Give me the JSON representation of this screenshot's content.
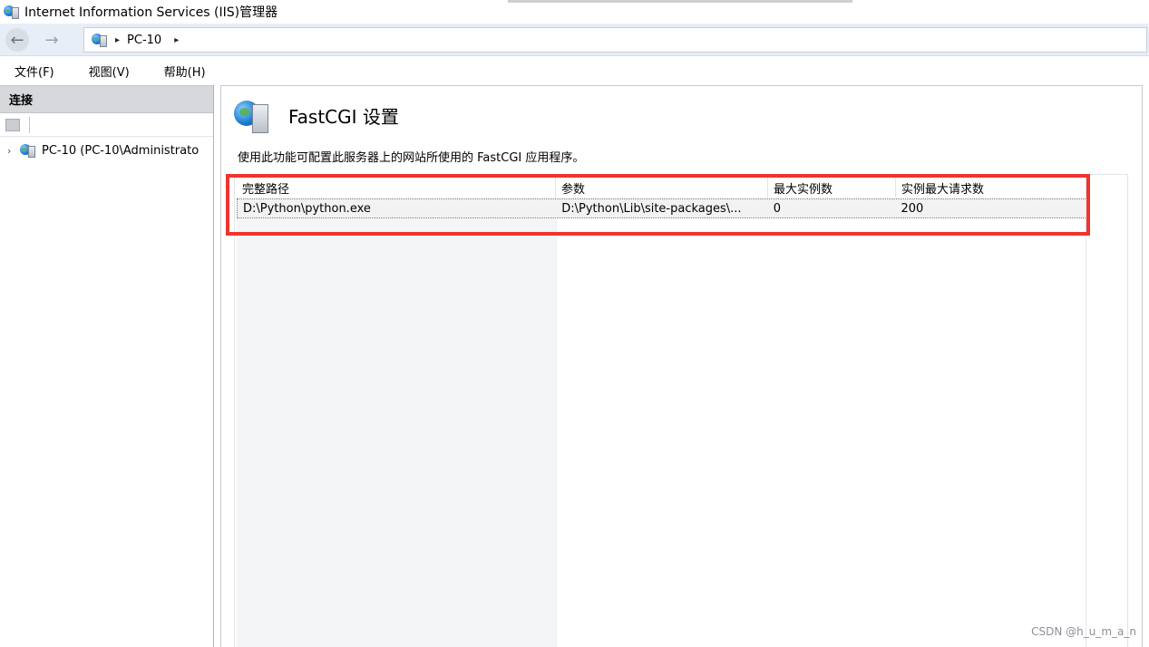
{
  "window": {
    "title": "Internet Information Services (IIS)管理器"
  },
  "address": {
    "crumb": "PC-10",
    "arrow": "▸"
  },
  "nav": {
    "back": "←",
    "forward": "→"
  },
  "menu": [
    "文件(F)",
    "视图(V)",
    "帮助(H)"
  ],
  "connections": {
    "header": "连接",
    "node": {
      "expander": "›",
      "label": "PC-10 (PC-10\\Administrato"
    }
  },
  "feature": {
    "title": "FastCGI 设置",
    "description": "使用此功能可配置此服务器上的网站所使用的 FastCGI 应用程序。"
  },
  "grid": {
    "columns": [
      "完整路径",
      "参数",
      "最大实例数",
      "实例最大请求数"
    ],
    "rows": [
      [
        "D:\\Python\\python.exe",
        "D:\\Python\\Lib\\site-packages\\...",
        "0",
        "200"
      ]
    ]
  },
  "highlight_color": "#f0342f",
  "watermark": "CSDN @h_u_m_a_n"
}
